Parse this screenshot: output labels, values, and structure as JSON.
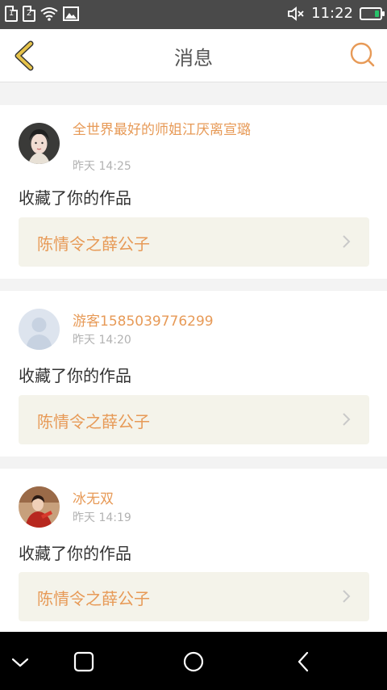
{
  "status_bar": {
    "sim1": "1",
    "sim2": "2",
    "time": "11:22",
    "icons": [
      "sim-1-icon",
      "sim-2-icon",
      "wifi-icon",
      "image-notification-icon",
      "mute-icon",
      "battery-icon"
    ]
  },
  "header": {
    "title": "消息",
    "back_icon": "chevron-left-icon",
    "search_icon": "search-icon",
    "accent": "#e79a57",
    "back_color": "#e6c34a"
  },
  "messages": [
    {
      "username": "全世界最好的师姐江厌离宣璐",
      "timestamp": "昨天 14:25",
      "action": "收藏了你的作品",
      "work_title": "陈情令之薛公子",
      "avatar": "avatar-woman-photo"
    },
    {
      "username": "游客1585039776299",
      "timestamp": "昨天 14:20",
      "action": "收藏了你的作品",
      "work_title": "陈情令之薛公子",
      "avatar": "avatar-default-silhouette"
    },
    {
      "username": "冰无双",
      "timestamp": "昨天 14:19",
      "action": "收藏了你的作品",
      "work_title": "陈情令之薛公子",
      "avatar": "avatar-red-costume-photo"
    }
  ],
  "system_nav": {
    "icons": [
      "collapse-icon",
      "recent-apps-icon",
      "home-icon",
      "back-icon"
    ]
  }
}
